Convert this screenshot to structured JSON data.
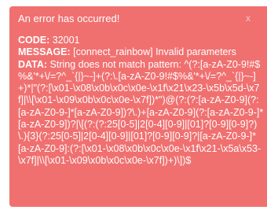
{
  "alert": {
    "title": "An error has occurred!",
    "close_glyph": "x",
    "code_label": "CODE:",
    "code_value": " 32001",
    "message_label": "MESSAGE:",
    "message_value": " [connect_rainbow] Invalid parameters",
    "data_label": "DATA:",
    "data_value": " String does not match pattern: ^(?:[a-zA-Z0-9!#$%&'*+\\/=?^_`{|}~-]+(?:\\.[a-zA-Z0-9!#$%&'*+\\/=?^_`{|}~-]+)*|\"(?:[\\x01-\\x08\\x0b\\x0c\\x0e-\\x1f\\x21\\x23-\\x5b\\x5d-\\x7f]|\\\\[\\x01-\\x09\\x0b\\x0c\\x0e-\\x7f])*\")@(?:(?:[a-zA-Z0-9](?:[a-zA-Z0-9-]*[a-zA-Z0-9])?\\.)+[a-zA-Z0-9](?:[a-zA-Z0-9-]*[a-zA-Z0-9])?|\\[(?:(?:25[0-5]|2[0-4][0-9]|[01]?[0-9][0-9]?)\\.){3}(?:25[0-5]|2[0-4][0-9]|[01]?[0-9][0-9]?|[a-zA-Z0-9-]*[a-zA-Z0-9]:(?:[\\x01-\\x08\\x0b\\x0c\\x0e-\\x1f\\x21-\\x5a\\x53-\\x7f]|\\\\[\\x01-\\x09\\x0b\\x0c\\x0e-\\x7f])+)\\])$"
  },
  "colors": {
    "alert_background": "#f07070",
    "text": "#ffffff"
  }
}
